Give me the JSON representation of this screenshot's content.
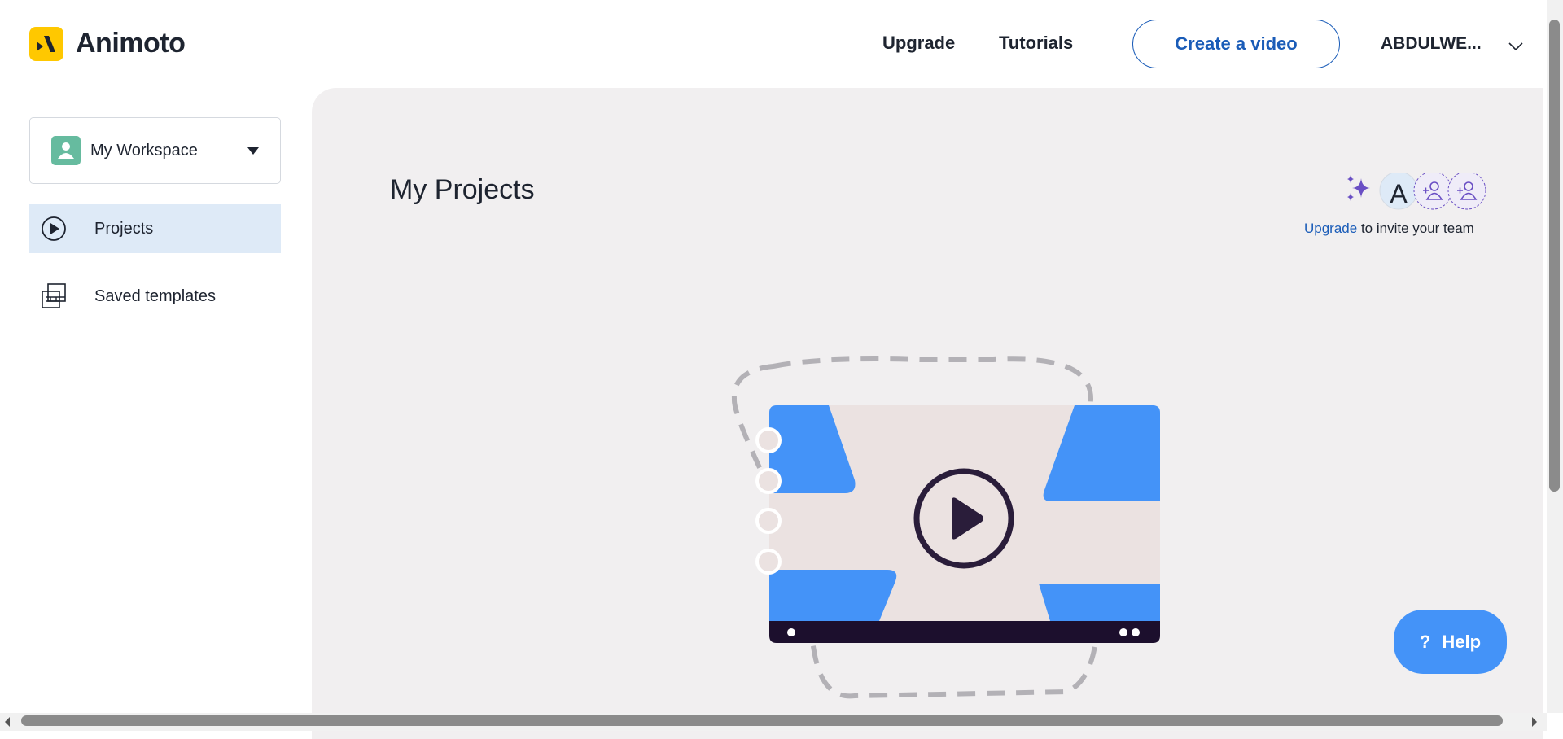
{
  "header": {
    "brand": "Animoto",
    "nav": [
      {
        "label": "Upgrade"
      },
      {
        "label": "Tutorials"
      }
    ],
    "create_label": "Create a video",
    "user_name": "ABDULWE..."
  },
  "sidebar": {
    "workspace": "My Workspace",
    "items": [
      {
        "label": "Projects",
        "active": true
      },
      {
        "label": "Saved templates"
      }
    ]
  },
  "main": {
    "title": "My Projects",
    "avatar_initial": "A",
    "invite_link": "Upgrade",
    "invite_text": " to invite your team"
  },
  "help": {
    "icon": "?",
    "label": "Help"
  },
  "colors": {
    "accent": "#1a5cb8",
    "brand": "#ffc800",
    "illustration_blue": "#4493f8",
    "panel": "#f1eff0",
    "active_item": "#deeaf7"
  }
}
